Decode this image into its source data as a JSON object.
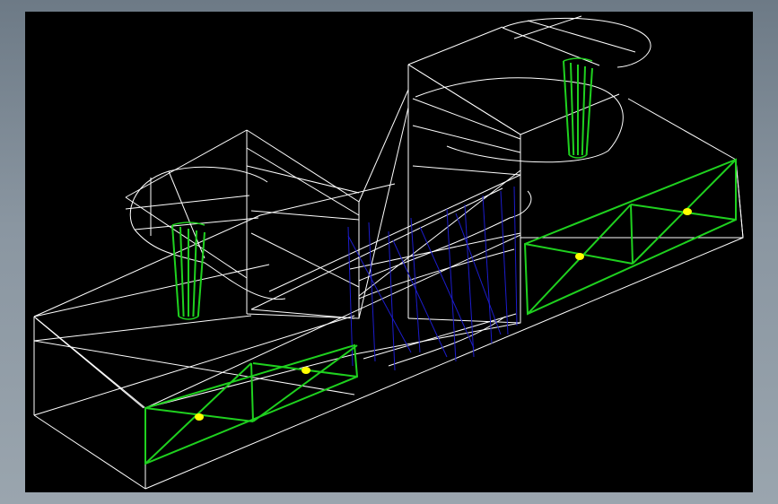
{
  "viewport": {
    "background": "#000000",
    "colors": {
      "edges": "#ffffff",
      "faces_green": "#1fd11f",
      "hidden_blue": "#1c1ccc",
      "points": "#ffff00"
    }
  }
}
